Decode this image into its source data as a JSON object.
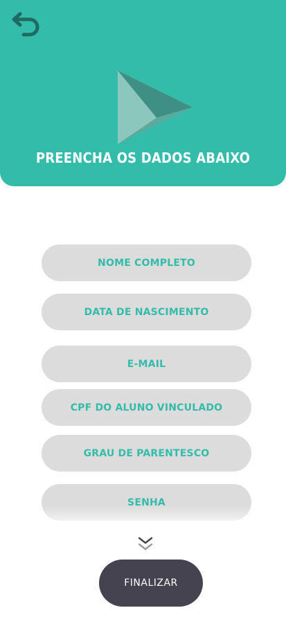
{
  "header": {
    "back_icon": "undo-arrow-icon",
    "logo_icon": "play-triangle-logo-icon",
    "title": "PREENCHA OS DADOS ABAIXO"
  },
  "form": {
    "fields": [
      {
        "label": "NOME COMPLETO"
      },
      {
        "label": "DATA DE NASCIMENTO"
      },
      {
        "label": "E-MAIL"
      },
      {
        "label": "CPF DO ALUNO VINCULADO"
      },
      {
        "label": "GRAU DE PARENTESCO"
      },
      {
        "label": "SENHA"
      }
    ],
    "scroll_icon": "double-chevron-down-icon",
    "submit_label": "FINALIZAR"
  },
  "colors": {
    "primary": "#34bcaa",
    "field_bg": "#dcdcdc",
    "button_bg": "#454350",
    "icon_dark": "#1f6a62"
  }
}
